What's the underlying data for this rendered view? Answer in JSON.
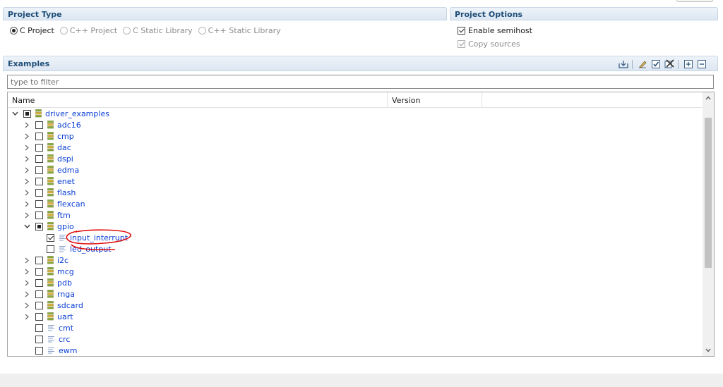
{
  "project_type": {
    "title": "Project Type",
    "options": [
      {
        "label": "C Project",
        "selected": true,
        "enabled": true
      },
      {
        "label": "C++ Project",
        "selected": false,
        "enabled": false
      },
      {
        "label": "C Static Library",
        "selected": false,
        "enabled": false
      },
      {
        "label": "C++ Static Library",
        "selected": false,
        "enabled": false
      }
    ]
  },
  "project_options": {
    "title": "Project Options",
    "enable_semihost": {
      "label": "Enable semihost",
      "checked": true,
      "enabled": true
    },
    "copy_sources": {
      "label": "Copy sources",
      "checked": true,
      "enabled": false
    }
  },
  "examples": {
    "title": "Examples",
    "filter_placeholder": "type to filter",
    "columns": {
      "name": "Name",
      "version": "Version"
    },
    "toolbar_icons": [
      "import-icon",
      "clear-icon",
      "select-all-icon",
      "deselect-all-icon",
      "expand-all-icon",
      "collapse-all-icon"
    ],
    "tree": [
      {
        "label": "driver_examples",
        "level": 0,
        "kind": "folder",
        "expanded": true,
        "check": "partial"
      },
      {
        "label": "adc16",
        "level": 1,
        "kind": "folder",
        "expanded": false,
        "check": "none"
      },
      {
        "label": "cmp",
        "level": 1,
        "kind": "folder",
        "expanded": false,
        "check": "none"
      },
      {
        "label": "dac",
        "level": 1,
        "kind": "folder",
        "expanded": false,
        "check": "none"
      },
      {
        "label": "dspi",
        "level": 1,
        "kind": "folder",
        "expanded": false,
        "check": "none"
      },
      {
        "label": "edma",
        "level": 1,
        "kind": "folder",
        "expanded": false,
        "check": "none"
      },
      {
        "label": "enet",
        "level": 1,
        "kind": "folder",
        "expanded": false,
        "check": "none"
      },
      {
        "label": "flash",
        "level": 1,
        "kind": "folder",
        "expanded": false,
        "check": "none"
      },
      {
        "label": "flexcan",
        "level": 1,
        "kind": "folder",
        "expanded": false,
        "check": "none"
      },
      {
        "label": "ftm",
        "level": 1,
        "kind": "folder",
        "expanded": false,
        "check": "none"
      },
      {
        "label": "gpio",
        "level": 1,
        "kind": "folder",
        "expanded": true,
        "check": "partial"
      },
      {
        "label": "input_interrupt",
        "level": 2,
        "kind": "file",
        "check": "checked"
      },
      {
        "label": "led_output",
        "level": 2,
        "kind": "file",
        "check": "none"
      },
      {
        "label": "i2c",
        "level": 1,
        "kind": "folder",
        "expanded": false,
        "check": "none"
      },
      {
        "label": "mcg",
        "level": 1,
        "kind": "folder",
        "expanded": false,
        "check": "none"
      },
      {
        "label": "pdb",
        "level": 1,
        "kind": "folder",
        "expanded": false,
        "check": "none"
      },
      {
        "label": "rnga",
        "level": 1,
        "kind": "folder",
        "expanded": false,
        "check": "none"
      },
      {
        "label": "sdcard",
        "level": 1,
        "kind": "folder",
        "expanded": false,
        "check": "none"
      },
      {
        "label": "uart",
        "level": 1,
        "kind": "folder",
        "expanded": false,
        "check": "none"
      },
      {
        "label": "cmt",
        "level": 1,
        "kind": "file",
        "check": "none"
      },
      {
        "label": "crc",
        "level": 1,
        "kind": "file",
        "check": "none"
      },
      {
        "label": "ewm",
        "level": 1,
        "kind": "file",
        "check": "none"
      }
    ]
  },
  "colors": {
    "header_text": "#1f4e79",
    "link_text": "#0a3fd6",
    "annotation": "#e01010",
    "folder_green": "#8fae3c",
    "folder_yellow": "#e0b63c"
  }
}
